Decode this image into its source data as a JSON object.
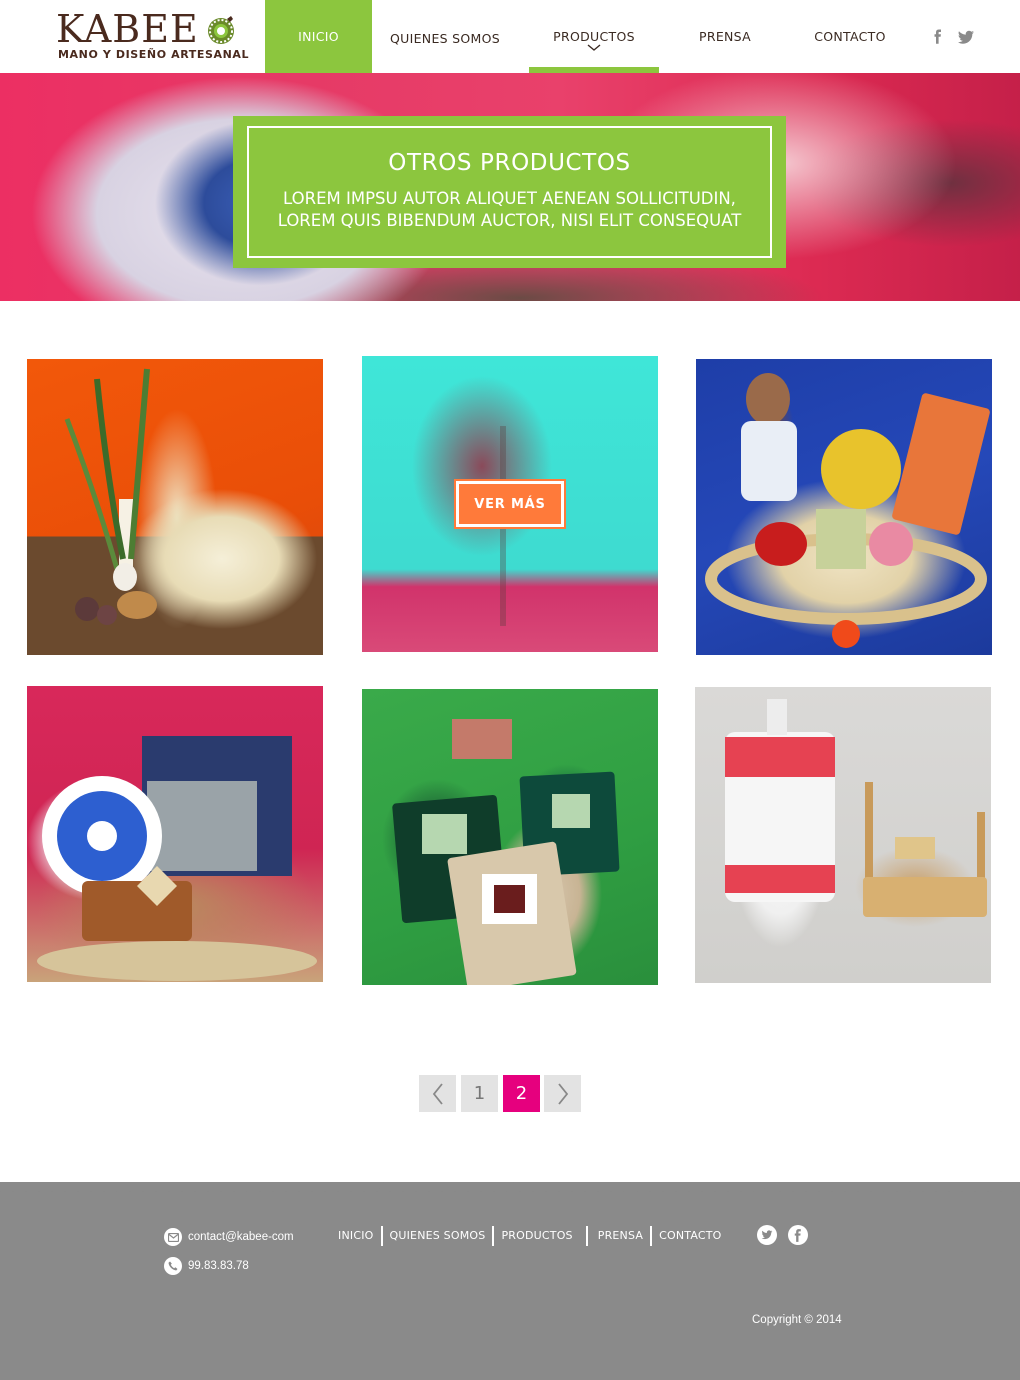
{
  "brand": {
    "name": "KABEE",
    "tagline": "MANO Y DISEÑO ARTESANAL"
  },
  "nav": {
    "items": [
      {
        "label": "INICIO",
        "state": "active"
      },
      {
        "label": "QUIENES SOMOS",
        "state": "normal"
      },
      {
        "label": "PRODUCTOS",
        "state": "current"
      },
      {
        "label": "PRENSA",
        "state": "normal"
      },
      {
        "label": "CONTACTO",
        "state": "normal"
      }
    ],
    "social": [
      "facebook-icon",
      "twitter-icon"
    ]
  },
  "hero": {
    "title": "OTROS PRODUCTOS",
    "subtitle_line1": "LOREM IMPSU AUTOR ALIQUET AENEAN SOLLICITUDIN,",
    "subtitle_line2": "LOREM QUIS BIBENDUM AUCTOR, NISI ELIT CONSEQUAT"
  },
  "products": {
    "hover_button": "VER MÁS",
    "tiles": [
      {
        "subject": "altar-cross-arrangement"
      },
      {
        "subject": "blurred-plant-hover"
      },
      {
        "subject": "doll-gift-basket"
      },
      {
        "subject": "embroidered-gift-basket"
      },
      {
        "subject": "paper-notebooks"
      },
      {
        "subject": "embroidered-bottle-hammock"
      }
    ]
  },
  "pagination": {
    "prev": "‹",
    "pages": [
      "1",
      "2"
    ],
    "current_page": "2",
    "next": "›"
  },
  "footer": {
    "email": "contact@kabee-com",
    "phone": "99.83.83.78",
    "nav": [
      "INICIO",
      "QUIENES SOMOS",
      "PRODUCTOS",
      "PRENSA",
      "CONTACTO"
    ],
    "social": [
      "twitter-icon",
      "facebook-icon"
    ],
    "copyright": "Copyright © 2014"
  },
  "colors": {
    "accent_green": "#8cc63e",
    "hover_orange": "#ff7a3a",
    "pagination_active": "#e6007e",
    "footer_gray": "#8a8a8a",
    "brand_brown": "#4a2a1e"
  }
}
